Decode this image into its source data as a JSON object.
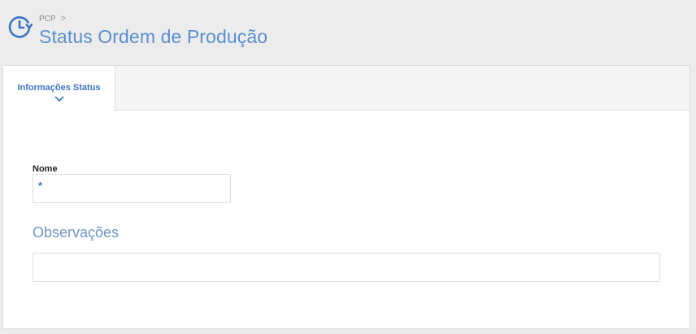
{
  "header": {
    "breadcrumb": "PCP",
    "breadcrumb_separator": ">",
    "title": "Status Ordem de Produção",
    "icon": "clock-refresh-icon"
  },
  "tabs": [
    {
      "label": "Informações Status",
      "active": true
    }
  ],
  "form": {
    "name_label": "Nome",
    "name_value": "",
    "name_required_mark": "*",
    "observations_label": "Observações",
    "observations_value": ""
  },
  "colors": {
    "accent": "#3d74c4",
    "title": "#5b8fd1",
    "background": "#ececec"
  }
}
